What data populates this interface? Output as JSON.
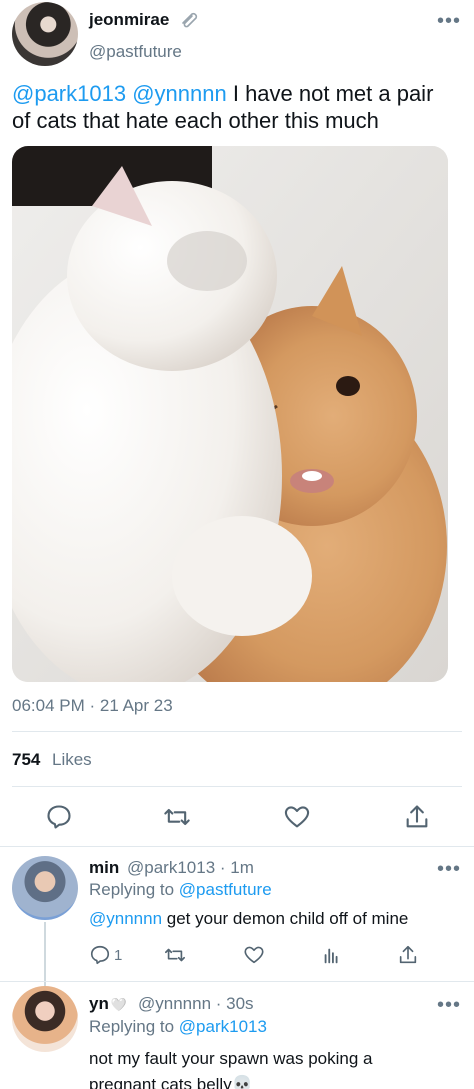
{
  "tweet": {
    "author_name": "jeonmirae",
    "author_handle": "@pastfuture",
    "more": "•••",
    "text_mentions": [
      "@park1013",
      "@ynnnnn"
    ],
    "text_line1": "I have not met a pair",
    "text_line2": "of cats that hate each other this much",
    "time": "06:04 PM · 21 Apr 23",
    "likes_count": "754",
    "likes_label": "Likes"
  },
  "replies": [
    {
      "name": "min",
      "handle_time": "@park1013 · 1m",
      "replying_prefix": "Replying to",
      "replying_to": "@pastfuture",
      "mention": "@ynnnnn",
      "text": "get your demon child off of mine",
      "reply_count": "1",
      "more": "•••"
    },
    {
      "name": "yn",
      "name_emoji": "🤍",
      "handle_time": "@ynnnnn · 30s",
      "replying_prefix": "Replying to",
      "replying_to": "@park1013",
      "text_line1": "not my fault your spawn was poking a",
      "text_line2": "pregnant cats belly💀",
      "more": "•••"
    }
  ],
  "icons": {
    "clip": "paperclip-icon",
    "reply": "reply-icon",
    "retweet": "retweet-icon",
    "like": "heart-icon",
    "share": "share-icon",
    "views": "views-icon"
  },
  "colors": {
    "link": "#1d9bf0",
    "muted": "#657786",
    "text": "#0f1419"
  }
}
